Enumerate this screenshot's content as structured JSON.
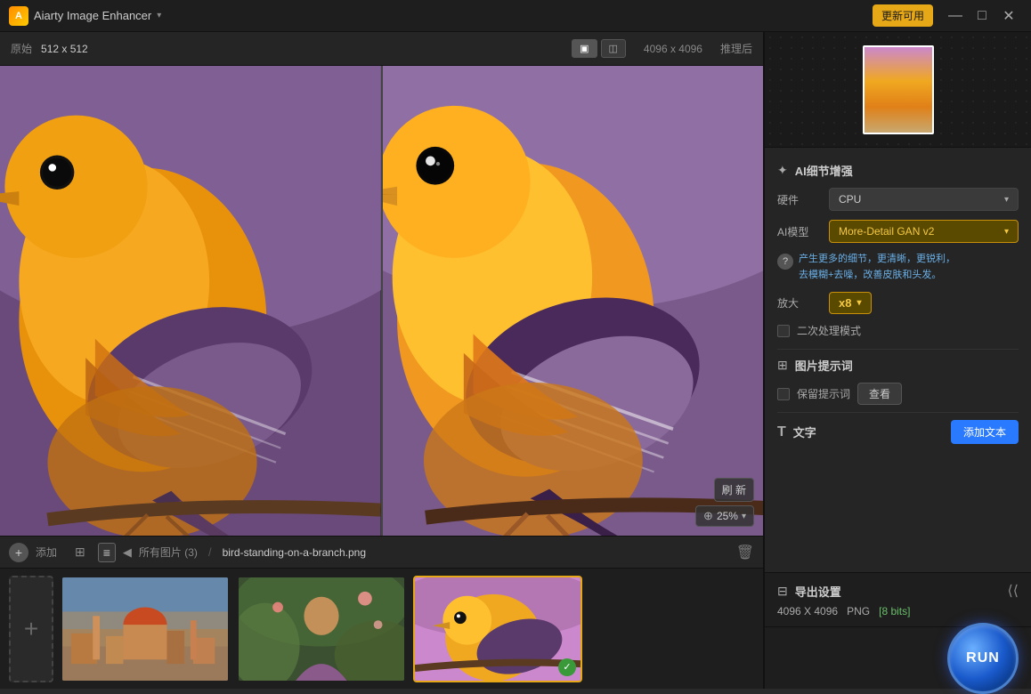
{
  "titlebar": {
    "app_name": "Aiarty Image Enhancer",
    "arrow": "▾",
    "update_btn": "更新可用",
    "minimize": "—",
    "maximize": "□",
    "close": "✕"
  },
  "topbar": {
    "orig_label": "原始",
    "orig_size": "512 x 512",
    "btn_single": "▣",
    "btn_split": "◫",
    "output_size": "4096 x 4096",
    "infer_label": "推理后"
  },
  "float_controls": {
    "refresh": "刷 新",
    "zoom_icon": "⊕",
    "zoom_value": "25%",
    "zoom_arrow": "▾"
  },
  "filmstrip": {
    "add_label": "添加",
    "view_grid": "⊞",
    "view_list": "≡",
    "back_arrow": "◀",
    "all_images": "所有图片 (3)",
    "separator": "/",
    "filename": "bird-standing-on-a-branch.png",
    "delete_icon": "🗑"
  },
  "right_panel": {
    "ai_enhance_icon": "✦",
    "ai_enhance_title": "AI细节增强",
    "hardware_label": "硬件",
    "hardware_value": "CPU",
    "ai_model_label": "AI模型",
    "ai_model_value": "More-Detail GAN v2",
    "help_text": "产生更多的细节，更清晰，更锐利，\n去模糊+去噪，改善皮肤和头发。",
    "zoom_label": "放大",
    "zoom_value": "x8",
    "secondary_mode": "二次处理模式",
    "image_hint_icon": "⊞",
    "image_hint_title": "图片提示词",
    "preserve_hint": "保留提示词",
    "view_btn": "查看",
    "text_icon": "T",
    "text_title": "文字",
    "add_text_btn": "添加文本",
    "export_icon": "⊟",
    "export_title": "导出设置",
    "export_size": "4096 X 4096",
    "export_format": "PNG",
    "export_bits": "[8 bits]",
    "run_btn": "RUN"
  }
}
